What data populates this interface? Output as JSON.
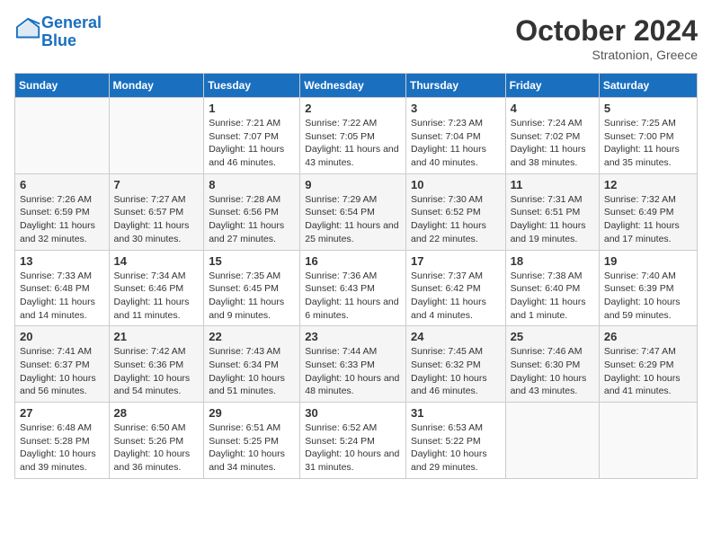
{
  "header": {
    "logo_line1": "General",
    "logo_line2": "Blue",
    "month": "October 2024",
    "location": "Stratonion, Greece"
  },
  "days_of_week": [
    "Sunday",
    "Monday",
    "Tuesday",
    "Wednesday",
    "Thursday",
    "Friday",
    "Saturday"
  ],
  "weeks": [
    [
      {
        "num": "",
        "info": ""
      },
      {
        "num": "",
        "info": ""
      },
      {
        "num": "1",
        "info": "Sunrise: 7:21 AM\nSunset: 7:07 PM\nDaylight: 11 hours and 46 minutes."
      },
      {
        "num": "2",
        "info": "Sunrise: 7:22 AM\nSunset: 7:05 PM\nDaylight: 11 hours and 43 minutes."
      },
      {
        "num": "3",
        "info": "Sunrise: 7:23 AM\nSunset: 7:04 PM\nDaylight: 11 hours and 40 minutes."
      },
      {
        "num": "4",
        "info": "Sunrise: 7:24 AM\nSunset: 7:02 PM\nDaylight: 11 hours and 38 minutes."
      },
      {
        "num": "5",
        "info": "Sunrise: 7:25 AM\nSunset: 7:00 PM\nDaylight: 11 hours and 35 minutes."
      }
    ],
    [
      {
        "num": "6",
        "info": "Sunrise: 7:26 AM\nSunset: 6:59 PM\nDaylight: 11 hours and 32 minutes."
      },
      {
        "num": "7",
        "info": "Sunrise: 7:27 AM\nSunset: 6:57 PM\nDaylight: 11 hours and 30 minutes."
      },
      {
        "num": "8",
        "info": "Sunrise: 7:28 AM\nSunset: 6:56 PM\nDaylight: 11 hours and 27 minutes."
      },
      {
        "num": "9",
        "info": "Sunrise: 7:29 AM\nSunset: 6:54 PM\nDaylight: 11 hours and 25 minutes."
      },
      {
        "num": "10",
        "info": "Sunrise: 7:30 AM\nSunset: 6:52 PM\nDaylight: 11 hours and 22 minutes."
      },
      {
        "num": "11",
        "info": "Sunrise: 7:31 AM\nSunset: 6:51 PM\nDaylight: 11 hours and 19 minutes."
      },
      {
        "num": "12",
        "info": "Sunrise: 7:32 AM\nSunset: 6:49 PM\nDaylight: 11 hours and 17 minutes."
      }
    ],
    [
      {
        "num": "13",
        "info": "Sunrise: 7:33 AM\nSunset: 6:48 PM\nDaylight: 11 hours and 14 minutes."
      },
      {
        "num": "14",
        "info": "Sunrise: 7:34 AM\nSunset: 6:46 PM\nDaylight: 11 hours and 11 minutes."
      },
      {
        "num": "15",
        "info": "Sunrise: 7:35 AM\nSunset: 6:45 PM\nDaylight: 11 hours and 9 minutes."
      },
      {
        "num": "16",
        "info": "Sunrise: 7:36 AM\nSunset: 6:43 PM\nDaylight: 11 hours and 6 minutes."
      },
      {
        "num": "17",
        "info": "Sunrise: 7:37 AM\nSunset: 6:42 PM\nDaylight: 11 hours and 4 minutes."
      },
      {
        "num": "18",
        "info": "Sunrise: 7:38 AM\nSunset: 6:40 PM\nDaylight: 11 hours and 1 minute."
      },
      {
        "num": "19",
        "info": "Sunrise: 7:40 AM\nSunset: 6:39 PM\nDaylight: 10 hours and 59 minutes."
      }
    ],
    [
      {
        "num": "20",
        "info": "Sunrise: 7:41 AM\nSunset: 6:37 PM\nDaylight: 10 hours and 56 minutes."
      },
      {
        "num": "21",
        "info": "Sunrise: 7:42 AM\nSunset: 6:36 PM\nDaylight: 10 hours and 54 minutes."
      },
      {
        "num": "22",
        "info": "Sunrise: 7:43 AM\nSunset: 6:34 PM\nDaylight: 10 hours and 51 minutes."
      },
      {
        "num": "23",
        "info": "Sunrise: 7:44 AM\nSunset: 6:33 PM\nDaylight: 10 hours and 48 minutes."
      },
      {
        "num": "24",
        "info": "Sunrise: 7:45 AM\nSunset: 6:32 PM\nDaylight: 10 hours and 46 minutes."
      },
      {
        "num": "25",
        "info": "Sunrise: 7:46 AM\nSunset: 6:30 PM\nDaylight: 10 hours and 43 minutes."
      },
      {
        "num": "26",
        "info": "Sunrise: 7:47 AM\nSunset: 6:29 PM\nDaylight: 10 hours and 41 minutes."
      }
    ],
    [
      {
        "num": "27",
        "info": "Sunrise: 6:48 AM\nSunset: 5:28 PM\nDaylight: 10 hours and 39 minutes."
      },
      {
        "num": "28",
        "info": "Sunrise: 6:50 AM\nSunset: 5:26 PM\nDaylight: 10 hours and 36 minutes."
      },
      {
        "num": "29",
        "info": "Sunrise: 6:51 AM\nSunset: 5:25 PM\nDaylight: 10 hours and 34 minutes."
      },
      {
        "num": "30",
        "info": "Sunrise: 6:52 AM\nSunset: 5:24 PM\nDaylight: 10 hours and 31 minutes."
      },
      {
        "num": "31",
        "info": "Sunrise: 6:53 AM\nSunset: 5:22 PM\nDaylight: 10 hours and 29 minutes."
      },
      {
        "num": "",
        "info": ""
      },
      {
        "num": "",
        "info": ""
      }
    ]
  ]
}
